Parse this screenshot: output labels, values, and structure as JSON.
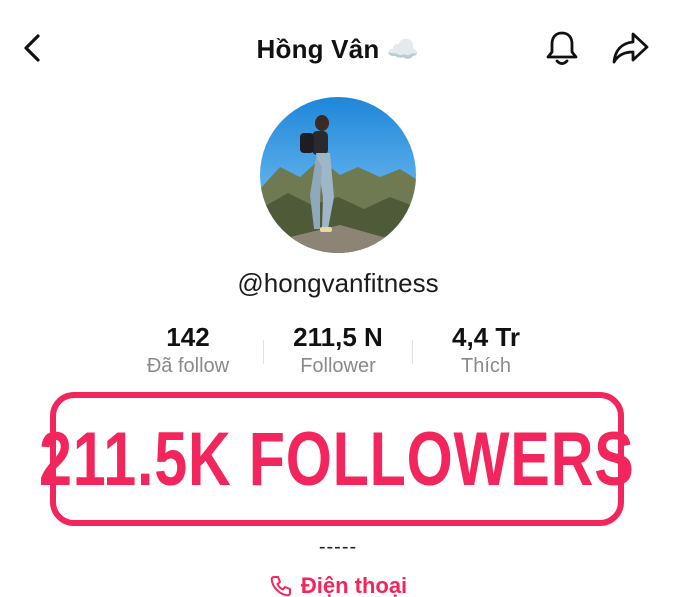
{
  "header": {
    "title": "Hồng Vân ☁️",
    "back_icon": "chevron-left-icon",
    "bell_icon": "bell-icon",
    "share_icon": "share-arrow-icon"
  },
  "profile": {
    "username": "@hongvanfitness",
    "stats": [
      {
        "value": "142",
        "label": "Đã follow"
      },
      {
        "value": "211,5 N",
        "label": "Follower"
      },
      {
        "value": "4,4 Tr",
        "label": "Thích"
      }
    ],
    "bio_dashes": "-----",
    "phone_label": "Điện thoại",
    "phone_icon": "phone-icon"
  },
  "overlay": {
    "text": "211.5K FOLLOWERS"
  },
  "colors": {
    "accent": "#f2265c",
    "text": "#111111",
    "muted": "#8a8a8a"
  }
}
